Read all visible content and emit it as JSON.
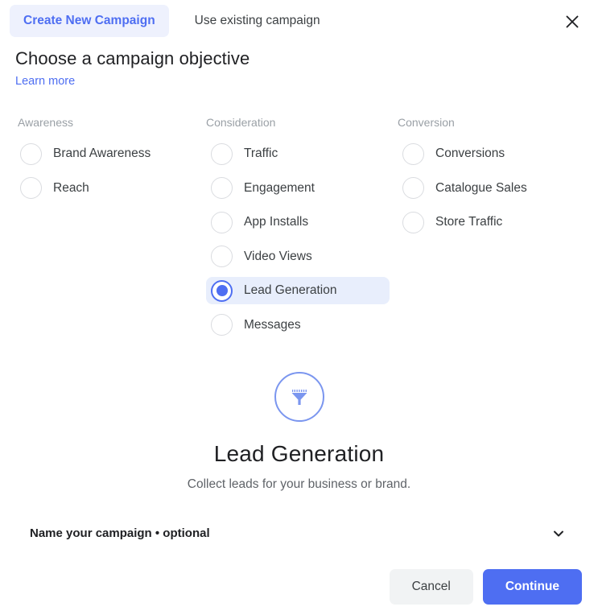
{
  "header": {
    "tabs": [
      {
        "label": "Create New Campaign",
        "active": true
      },
      {
        "label": "Use existing campaign",
        "active": false
      }
    ],
    "close_icon": "close-icon"
  },
  "page": {
    "title": "Choose a campaign objective",
    "learn_more": "Learn more"
  },
  "objectives": {
    "columns": [
      {
        "title": "Awareness",
        "options": [
          {
            "label": "Brand Awareness",
            "selected": false
          },
          {
            "label": "Reach",
            "selected": false
          }
        ]
      },
      {
        "title": "Consideration",
        "options": [
          {
            "label": "Traffic",
            "selected": false
          },
          {
            "label": "Engagement",
            "selected": false
          },
          {
            "label": "App Installs",
            "selected": false
          },
          {
            "label": "Video Views",
            "selected": false
          },
          {
            "label": "Lead Generation",
            "selected": true
          },
          {
            "label": "Messages",
            "selected": false
          }
        ]
      },
      {
        "title": "Conversion",
        "options": [
          {
            "label": "Conversions",
            "selected": false
          },
          {
            "label": "Catalogue Sales",
            "selected": false
          },
          {
            "label": "Store Traffic",
            "selected": false
          }
        ]
      }
    ]
  },
  "hero": {
    "icon": "funnel-icon",
    "title": "Lead Generation",
    "subtitle": "Collect leads for your business or brand."
  },
  "campaign_name": {
    "label": "Name your campaign • optional",
    "expand_icon": "chevron-down-icon"
  },
  "footer": {
    "cancel_label": "Cancel",
    "continue_label": "Continue"
  },
  "colors": {
    "accent": "#4e6ef2",
    "tab_active_bg": "#eef1fd",
    "selected_row_bg": "#e8eefc",
    "muted_text": "#9aa0a6",
    "cancel_bg": "#f1f3f4"
  }
}
